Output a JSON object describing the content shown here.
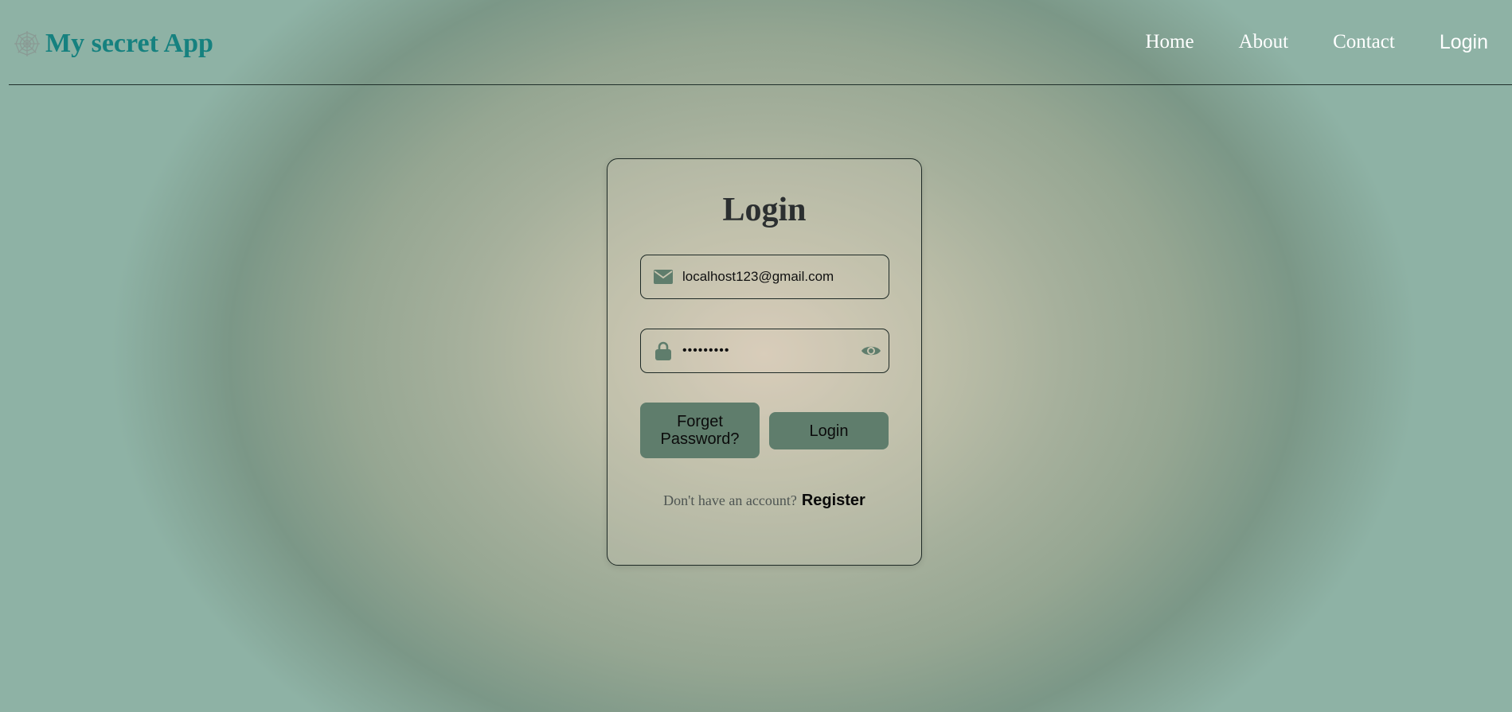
{
  "app": {
    "brand": "My secret App",
    "brand_color": "#16817f",
    "brand_icon": "spider-web-icon"
  },
  "nav": {
    "items": [
      {
        "label": "Home"
      },
      {
        "label": "About"
      },
      {
        "label": "Contact"
      },
      {
        "label": "Login"
      }
    ]
  },
  "login_form": {
    "title": "Login",
    "email": {
      "value": "localhost123@gmail.com",
      "icon": "envelope-icon"
    },
    "password": {
      "value": "•••••••••",
      "icon": "lock-icon",
      "toggle_icon": "eye-icon"
    },
    "forget_button": "Forget Password?",
    "login_button": "Login",
    "register_prompt": "Don't have an account?",
    "register_link": "Register",
    "accent_color": "#5f7d6c"
  }
}
